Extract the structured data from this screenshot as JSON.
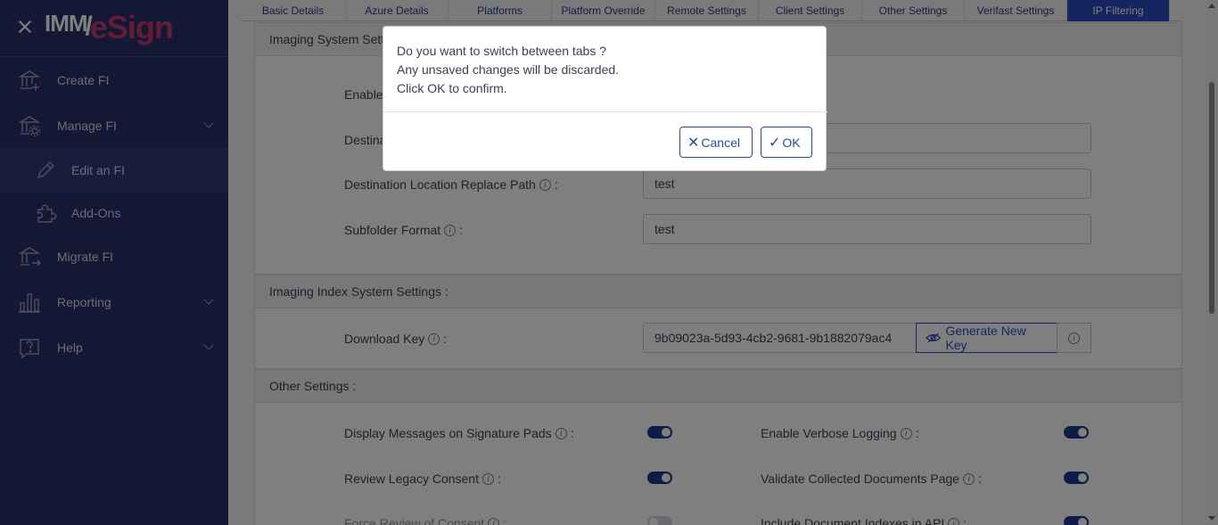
{
  "brand": {
    "part1": "IMM",
    "part2": "eSign"
  },
  "sidebar": {
    "items": [
      {
        "label": "Create FI",
        "icon": "bank-plus-icon"
      },
      {
        "label": "Manage FI",
        "icon": "bank-gear-icon"
      },
      {
        "label": "Edit an FI",
        "icon": "pencil-icon"
      },
      {
        "label": "Add-Ons",
        "icon": "puzzle-icon"
      },
      {
        "label": "Migrate FI",
        "icon": "bank-arrow-icon"
      },
      {
        "label": "Reporting",
        "icon": "bar-chart-icon"
      },
      {
        "label": "Help",
        "icon": "question-icon"
      }
    ]
  },
  "tabs": [
    "Basic Details",
    "Azure Details",
    "Platforms",
    "Platform Override",
    "Remote Settings",
    "Client Settings",
    "Other Settings",
    "Verifast Settings",
    "IP Filtering"
  ],
  "imaging": {
    "title": "Imaging System Settings :",
    "enable_label": "Enable",
    "destination_label": "Destina",
    "replace_path_label": "Destination Location Replace Path",
    "replace_path_value": "test",
    "subfolder_label": "Subfolder Format",
    "subfolder_value": "test"
  },
  "index": {
    "title": "Imaging Index System Settings :",
    "download_key_label": "Download Key",
    "download_key_value": "9b09023a-5d93-4cb2-9681-9b1882079ac4",
    "generate_label": "Generate New Key"
  },
  "other": {
    "title": "Other Settings :",
    "display_messages": "Display Messages on Signature Pads",
    "verbose_logging": "Enable Verbose Logging",
    "review_legacy": "Review Legacy Consent",
    "validate_docs": "Validate Collected Documents Page",
    "force_review": "Force Review of Consent",
    "include_indexes": "Include Document Indexes in API"
  },
  "colon": ":",
  "modal": {
    "line1": "Do you want to switch between tabs ?",
    "line2": "Any unsaved changes will be discarded.",
    "line3": "Click OK to confirm.",
    "cancel_label": "Cancel",
    "ok_label": "OK"
  },
  "colors": {
    "sidebar_bg": "#29306a",
    "accent": "#2b4ac0",
    "brand_pink": "#c03a6a"
  }
}
